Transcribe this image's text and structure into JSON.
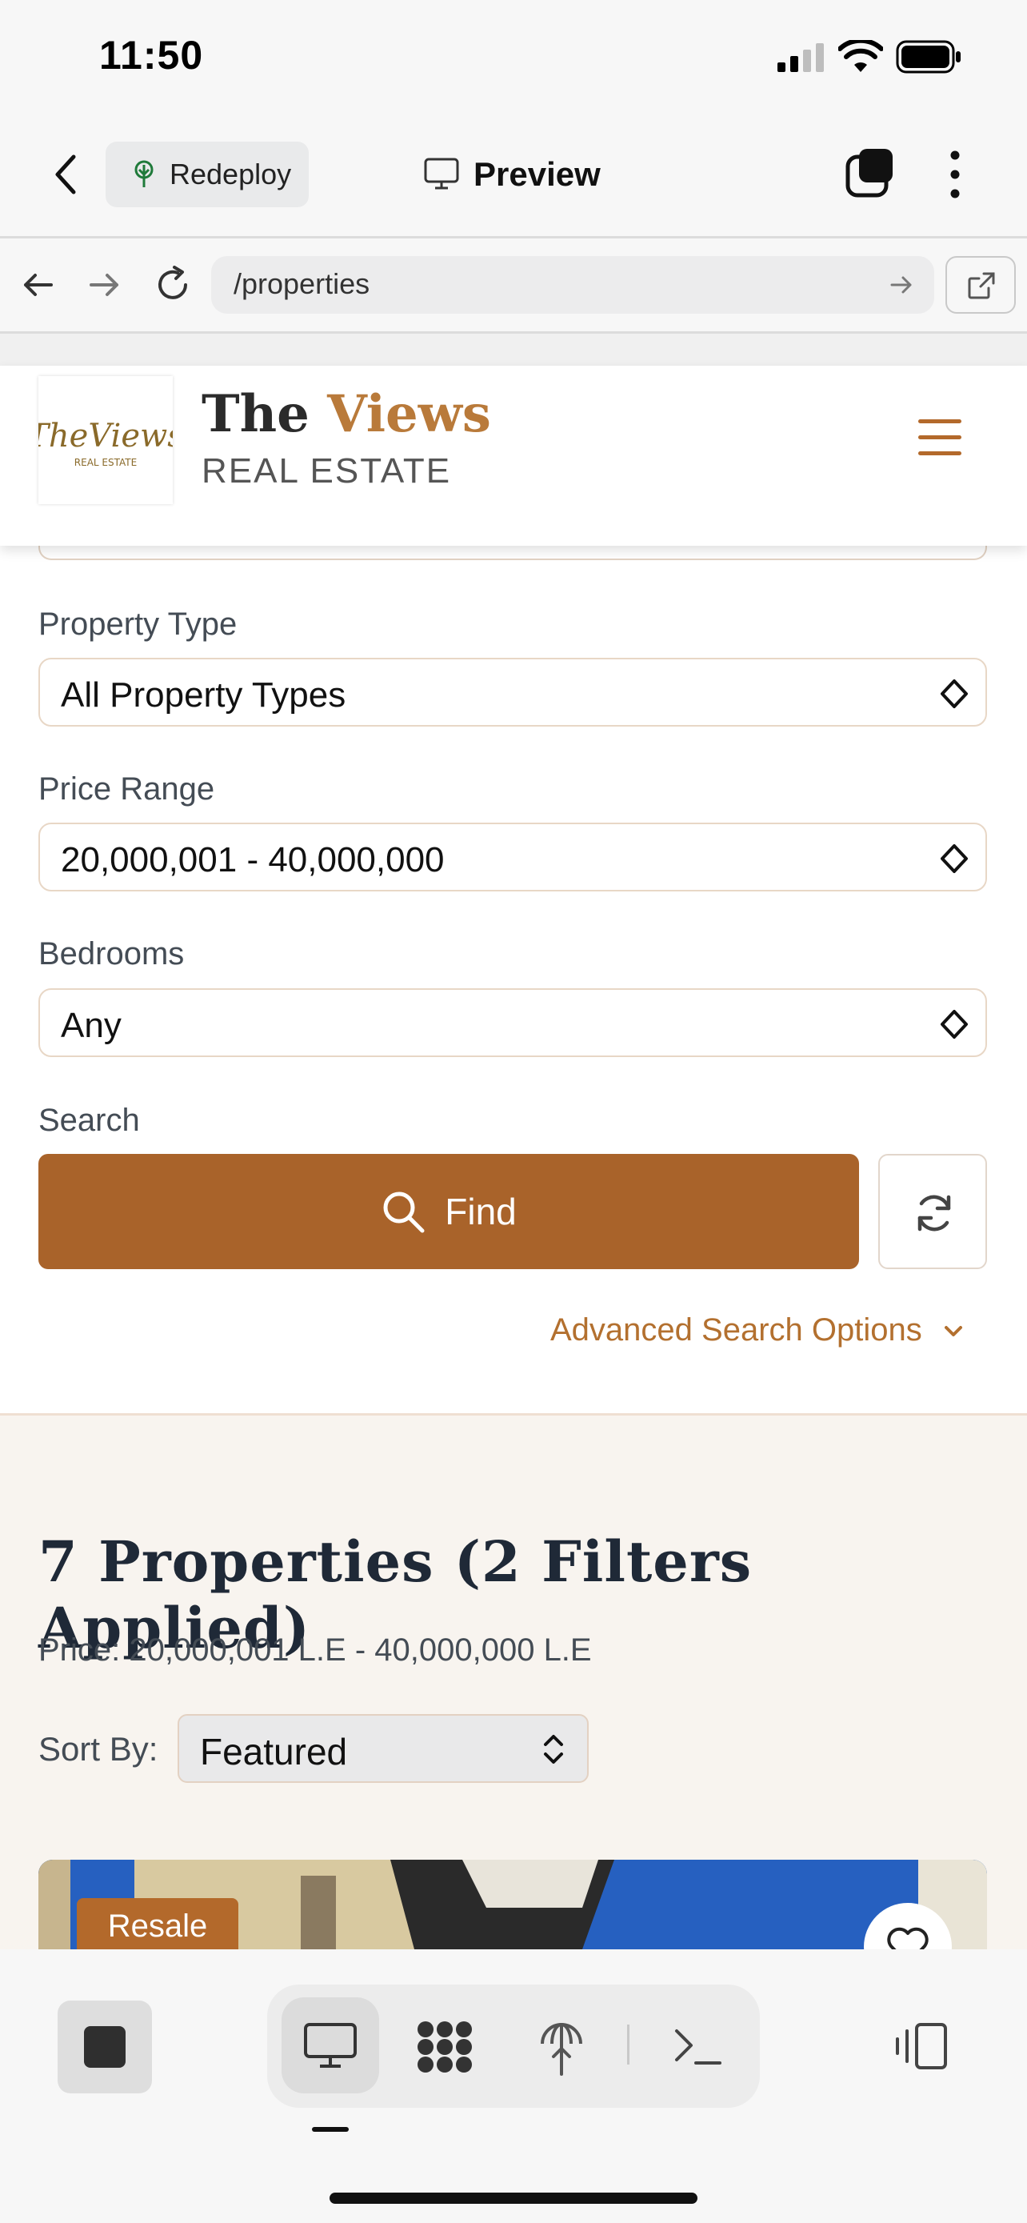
{
  "status_bar": {
    "time": "11:50"
  },
  "app_header": {
    "redeploy_label": "Redeploy",
    "preview_label": "Preview"
  },
  "browser": {
    "url": "/properties"
  },
  "site": {
    "brand_name_part1": "The ",
    "brand_name_part2": "Views",
    "brand_sub": "REAL ESTATE",
    "logo_text": "TheViews",
    "logo_sub": "REAL ESTATE",
    "accent_color": "#b3692b"
  },
  "filters": {
    "property_type": {
      "label": "Property Type",
      "value": "All Property Types"
    },
    "price_range": {
      "label": "Price Range",
      "value": "20,000,001 - 40,000,000"
    },
    "bedrooms": {
      "label": "Bedrooms",
      "value": "Any"
    },
    "search": {
      "label": "Search",
      "button": "Find"
    },
    "advanced_link": "Advanced Search Options"
  },
  "results": {
    "title": "7 Properties (2 Filters Applied)",
    "price_summary": "Price: 20,000,001 L.E - 40,000,000 L.E",
    "sort_label": "Sort By:",
    "sort_value": "Featured",
    "first_card_badge": "Resale"
  }
}
